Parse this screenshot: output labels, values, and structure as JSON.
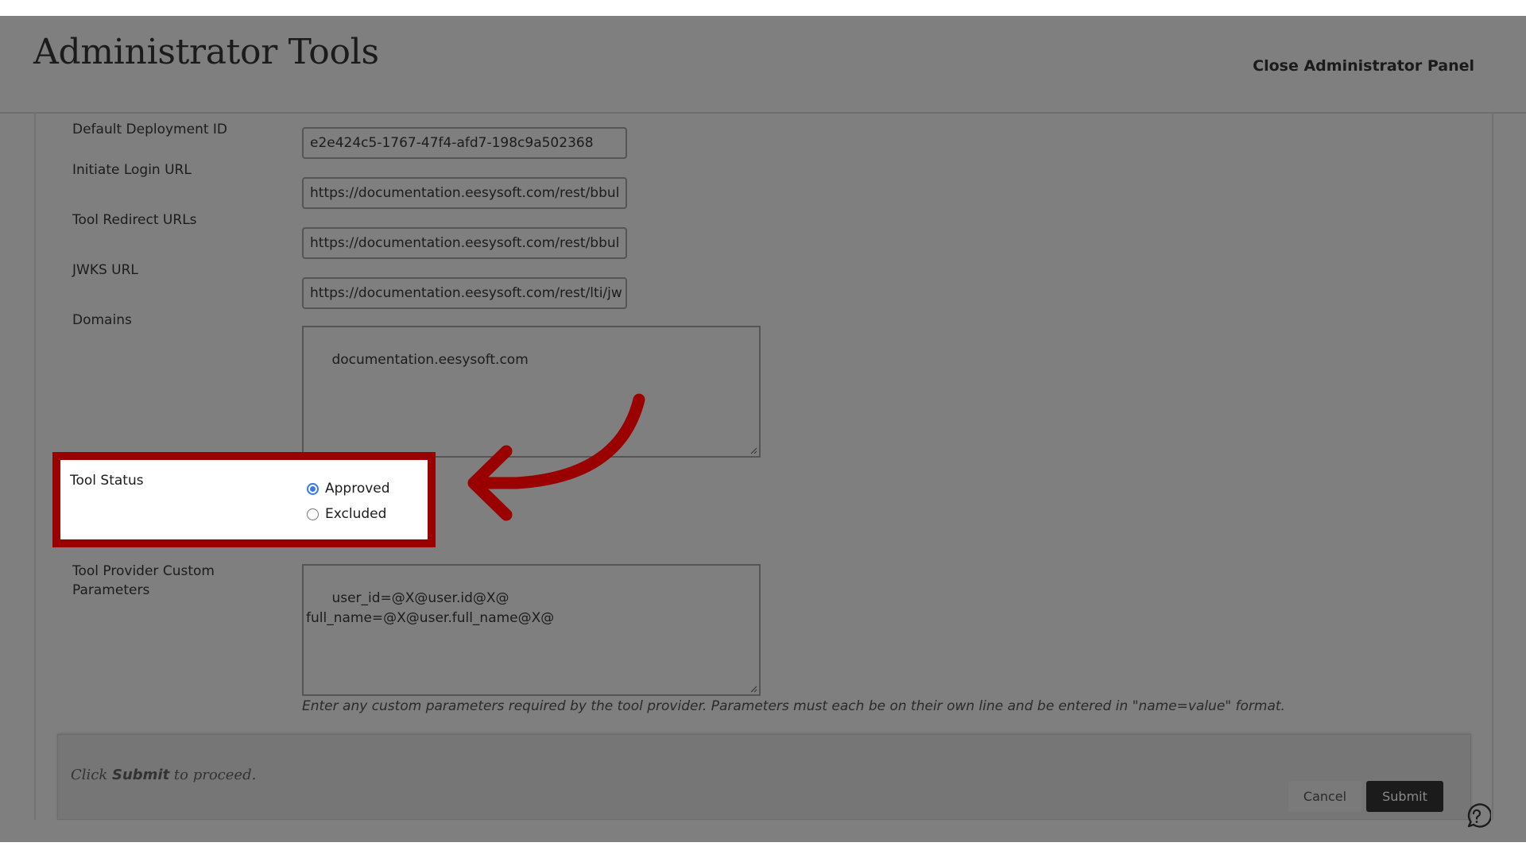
{
  "header": {
    "title": "Administrator Tools",
    "close_link": "Close Administrator Panel"
  },
  "fields": [
    {
      "label": "Default Deployment ID",
      "value": "e2e424c5-1767-47f4-afd7-198c9a502368"
    },
    {
      "label": "Initiate Login URL",
      "value": "https://documentation.eesysoft.com/rest/bbul"
    },
    {
      "label": "Tool Redirect URLs",
      "value": "https://documentation.eesysoft.com/rest/bbul"
    },
    {
      "label": "JWKS URL",
      "value": "https://documentation.eesysoft.com/rest/lti/jw"
    }
  ],
  "domains": {
    "label": "Domains",
    "value": "documentation.eesysoft.com"
  },
  "tool_status": {
    "label": "Tool Status",
    "options": [
      {
        "label": "Approved",
        "checked": true
      },
      {
        "label": "Excluded",
        "checked": false
      }
    ]
  },
  "custom_params": {
    "label_line1": "Tool Provider Custom",
    "label_line2": "Parameters",
    "value": "user_id=@X@user.id@X@\nfull_name=@X@user.full_name@X@",
    "hint": "Enter any custom parameters required by the tool provider. Parameters must each be on their own line and be entered in \"name=value\" format."
  },
  "footer": {
    "text_before": "Click ",
    "text_bold": "Submit",
    "text_after": " to proceed.",
    "cancel_label": "Cancel",
    "submit_label": "Submit"
  },
  "annotation": {
    "highlight_color": "#9b0000",
    "icon": "curved-arrow-icon"
  },
  "colors": {
    "radio_accent": "#3b78e7",
    "overlay_grey": "#7f7f7f"
  }
}
